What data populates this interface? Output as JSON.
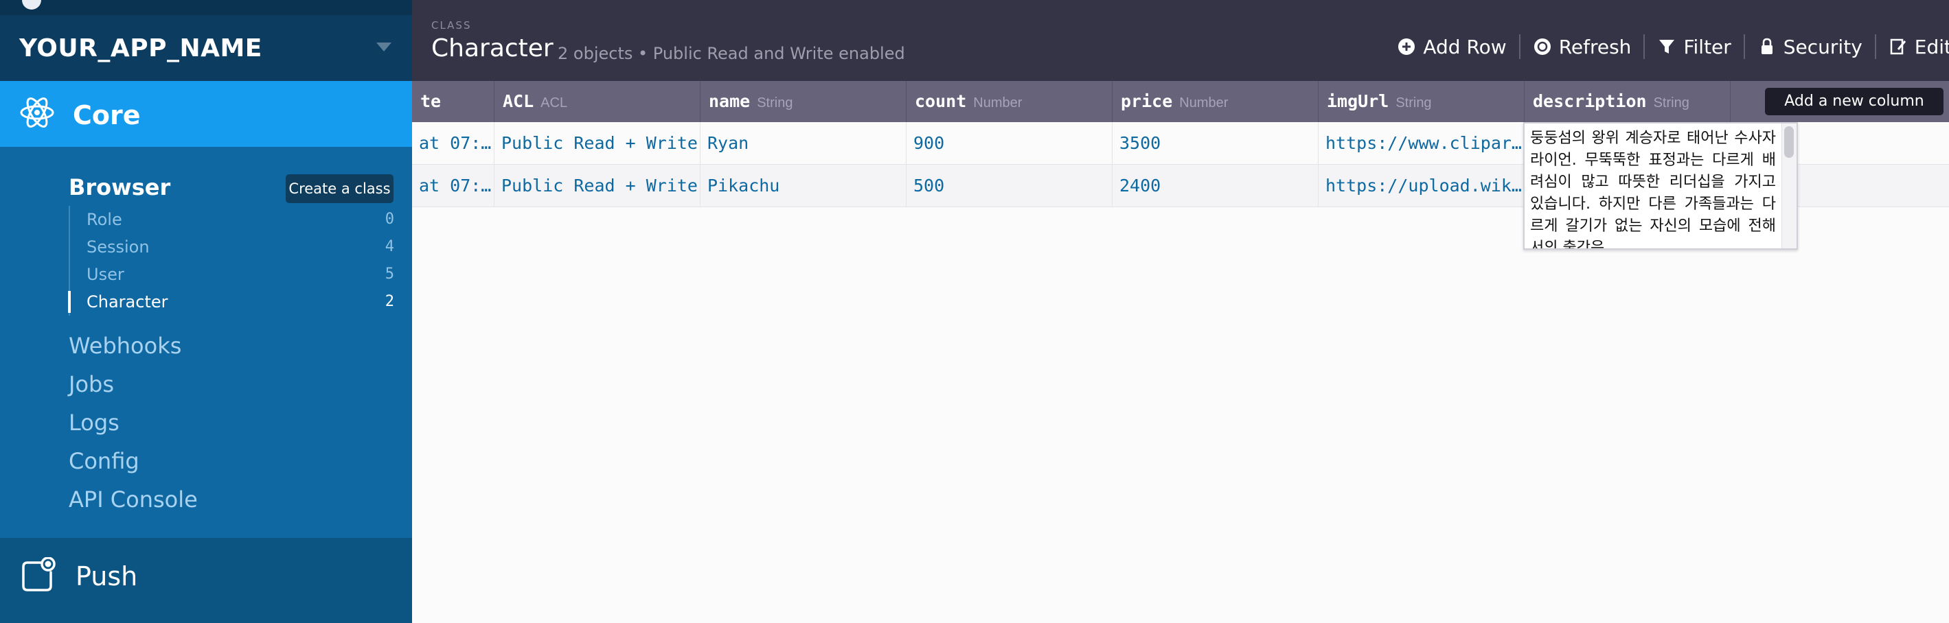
{
  "app": {
    "name": "YOUR_APP_NAME"
  },
  "sidebar": {
    "core_label": "Core",
    "browser_label": "Browser",
    "create_class_label": "Create a class",
    "classes": [
      {
        "name": "Role",
        "count": "0"
      },
      {
        "name": "Session",
        "count": "4"
      },
      {
        "name": "User",
        "count": "5"
      },
      {
        "name": "Character",
        "count": "2"
      }
    ],
    "nav": [
      "Webhooks",
      "Jobs",
      "Logs",
      "Config",
      "API Console"
    ],
    "push_label": "Push"
  },
  "header": {
    "kicker": "CLASS",
    "title": "Character",
    "subtitle": "2 objects • Public Read and Write enabled",
    "toolbar": {
      "add_row": "Add Row",
      "refresh": "Refresh",
      "filter": "Filter",
      "security": "Security",
      "edit": "Edit"
    }
  },
  "grid": {
    "columns": [
      {
        "name": "te",
        "type": ""
      },
      {
        "name": "ACL",
        "type": "ACL"
      },
      {
        "name": "name",
        "type": "String"
      },
      {
        "name": "count",
        "type": "Number"
      },
      {
        "name": "price",
        "type": "Number"
      },
      {
        "name": "imgUrl",
        "type": "String"
      },
      {
        "name": "description",
        "type": "String"
      }
    ],
    "add_column_label": "Add a new column",
    "rows": [
      {
        "date": "at 07:…",
        "acl": "Public Read + Write",
        "name": "Ryan",
        "count": "900",
        "price": "3500",
        "imgUrl": "https://www.clipar…"
      },
      {
        "date": "at 07:…",
        "acl": "Public Read + Write",
        "name": "Pikachu",
        "count": "500",
        "price": "2400",
        "imgUrl": "https://upload.wik…"
      }
    ],
    "description_text": "둥둥섬의 왕위 계승자로 태어난 수사자 라이언. 무뚝뚝한 표정과는 다르게 배려심이 많고 따뜻한 리더십을 가지고 있습니다. 하지만 다른 가족들과는 다르게 갈기가 없는 자신의 모습에 전해서의 출간은 "
  }
}
